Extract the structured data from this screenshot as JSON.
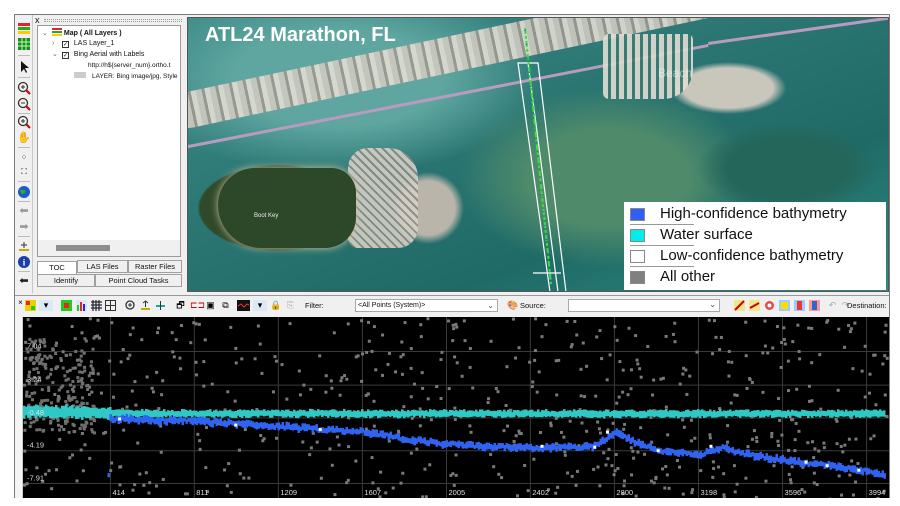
{
  "toc": {
    "close_label": "x",
    "root": "Map ( All Layers )",
    "layers": [
      {
        "label": "LAS Layer_1",
        "checked": true,
        "expanded": false
      },
      {
        "label": "Bing Aerial with Labels",
        "checked": true,
        "expanded": true
      }
    ],
    "bing_url": "http://h${server_num}.ortho.t",
    "bing_layer": "LAYER: Bing image/jpg, Style",
    "tabs_row1": [
      "TOC",
      "LAS Files",
      "Raster Files"
    ],
    "tabs_row2": [
      "Identify",
      "Point Cloud Tasks"
    ],
    "active_tab": "TOC"
  },
  "vertical_toolbar": {
    "icons": [
      "layers-icon",
      "table-icon",
      "select-arrow-icon",
      "zoom-in-icon",
      "zoom-out-icon",
      "zoom-window-icon",
      "pan-hand-icon",
      "zoom-extent-icon",
      "full-extent-icon",
      "globe-icon",
      "back-arrow-icon",
      "forward-arrow-icon",
      "profile-tool-icon",
      "info-icon",
      "pin-icon"
    ]
  },
  "map": {
    "title": "ATL24 Marathon, FL",
    "place_labels": [
      "Boot Key",
      "Beach"
    ],
    "legend": [
      {
        "label": "High-confidence bathymetry",
        "color": "#2f5ff5"
      },
      {
        "label": "Water surface",
        "color": "#00eeee"
      },
      {
        "label": "Low-confidence bathymetry",
        "color": "#ffffff"
      },
      {
        "label": "All other",
        "color": "#808080"
      }
    ]
  },
  "profile_toolbar": {
    "filter_label": "Filter:",
    "filter_value": "<All Points (System)>",
    "source_label": "Source:",
    "source_value": "",
    "destination_label": "Destination:"
  },
  "chart_data": {
    "type": "scatter",
    "title": "",
    "xlabel": "",
    "ylabel": "",
    "y_ticks": [
      7.04,
      3.24,
      -0.48,
      -4.19,
      -7.91
    ],
    "x_ticks": [
      414,
      811,
      1209,
      1607,
      2005,
      2402,
      2800,
      3198,
      3596,
      3994
    ],
    "xlim": [
      0,
      4100
    ],
    "ylim": [
      -10,
      10.5
    ],
    "grid": true,
    "series": [
      {
        "name": "Water surface",
        "color": "#2ec9c4",
        "x": [
          0,
          200,
          414,
          811,
          1209,
          1607,
          2005,
          2402,
          2800,
          3198,
          3596,
          3994,
          4080
        ],
        "y": [
          -0.2,
          -0.25,
          -0.4,
          -0.45,
          -0.45,
          -0.45,
          -0.45,
          -0.45,
          -0.45,
          -0.45,
          -0.45,
          -0.45,
          -0.45
        ]
      },
      {
        "name": "High-confidence bathymetry",
        "color": "#2f63f0",
        "x": [
          400,
          600,
          811,
          1000,
          1209,
          1400,
          1607,
          1800,
          2005,
          2200,
          2402,
          2600,
          2700,
          2800,
          2900,
          3000,
          3198,
          3300,
          3400,
          3596,
          3800,
          3994,
          4080
        ],
        "y": [
          -1.0,
          -1.2,
          -1.3,
          -1.6,
          -1.9,
          -2.2,
          -2.5,
          -3.3,
          -3.9,
          -4.2,
          -4.3,
          -4.3,
          -4.2,
          -2.5,
          -3.8,
          -4.6,
          -5.1,
          -4.3,
          -5.0,
          -5.7,
          -6.3,
          -7.0,
          -7.4
        ]
      },
      {
        "name": "Low-confidence bathymetry",
        "color": "#ffffff",
        "x": [
          450,
          1000,
          1400,
          2450,
          2700,
          2760,
          3000,
          3250,
          3700,
          3800,
          3950
        ],
        "y": [
          -1.1,
          -1.8,
          -2.3,
          -4.2,
          -4.3,
          -2.6,
          -4.7,
          -4.2,
          -6.0,
          -6.4,
          -6.9
        ]
      },
      {
        "name": "All other",
        "color": "#808080",
        "x": [],
        "y": []
      }
    ]
  }
}
